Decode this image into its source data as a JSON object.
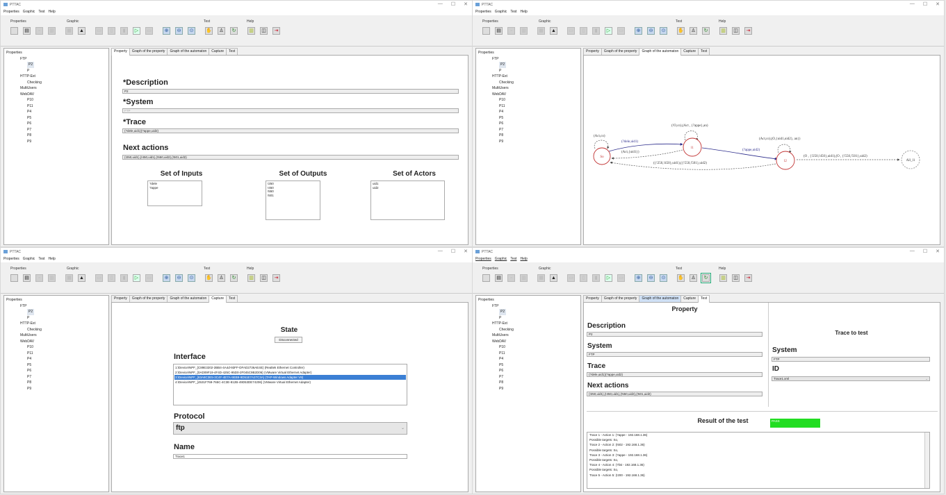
{
  "app": {
    "title": "PTTAC",
    "menu": [
      "Properties",
      "Graphic",
      "Test",
      "Help"
    ],
    "groups": [
      "Properties",
      "Graphic",
      "Test",
      "Help"
    ],
    "controls": [
      "—",
      "☐",
      "✕"
    ]
  },
  "tree": {
    "root": "Properties",
    "items": [
      {
        "label": "FTP",
        "level": 1
      },
      {
        "label": "P2",
        "level": 2,
        "selected": true
      },
      {
        "label": "P",
        "level": 2
      },
      {
        "label": "HTTP-Ext",
        "level": 1
      },
      {
        "label": "Checking",
        "level": 2
      },
      {
        "label": "MultiUsers",
        "level": 1
      },
      {
        "label": "WebDAV",
        "level": 1
      },
      {
        "label": "P10",
        "level": 2
      },
      {
        "label": "P11",
        "level": 2
      },
      {
        "label": "P4",
        "level": 2
      },
      {
        "label": "P5",
        "level": 2
      },
      {
        "label": "P6",
        "level": 2
      },
      {
        "label": "P7",
        "level": 2
      },
      {
        "label": "P8",
        "level": 2
      },
      {
        "label": "P9",
        "level": 2
      }
    ]
  },
  "tabs": [
    "Property",
    "Graph of the property",
    "Graph of the automaton",
    "Capture",
    "Test"
  ],
  "property": {
    "description_label": "*Description",
    "description_value": "P2",
    "system_label": "*System",
    "system_value": "FTP",
    "trace_label": "*Trace",
    "trace_value": "(?dele,uid1)(?appe,uid2)",
    "next_label": "Next actions",
    "next_value": "(!250,uid1),(!450,uid1),(!550,uid2),(!501,uid2)",
    "inputs_label": "Set of Inputs",
    "inputs": [
      "?dele",
      "?appe"
    ],
    "outputs_label": "Set of Outputs",
    "outputs": [
      "!250",
      "!450",
      "!550",
      "!501"
    ],
    "actors_label": "Set of Actors",
    "actors": [
      "uid1",
      "uid2"
    ]
  },
  "graph": {
    "nodes": [
      "So",
      "l1",
      "l2",
      "All_l1"
    ],
    "labels": [
      "(Act,co)",
      "(!O,co),(Act , {?appe},an)",
      "(?dele,uid1)",
      "(Act,{uid1})",
      "(Act,co),(O,{uid1,uid2}, an})",
      "(?appe,uid2)",
      "({!250,!450},uid1),({!550,!501},uid2)",
      "(O , {!250,!450},uid1),(O , {!550,!501},uid2)"
    ]
  },
  "capture": {
    "state_label": "State",
    "state_value": "Disconnected",
    "interface_label": "Interface",
    "interfaces": [
      "1:\\Device\\NPF_{C89E3202-2BB4-4A4d-93FF-DFAD2736AE4E} (Realtek Ethernet Controller)",
      "2:\\Device\\NPF_{0AD09F19-4F4D-425C-95D0-2F045C9B2D06} (VMware Virtual Ethernet Adapter)",
      "3:\\Device\\NPF_{63A8C3E5-3C4F-4E7A-9EB9-9D51E7A27C3A} (TAP-Windows Adapter V9)",
      "4:\\Device\\NPF_{4531F769-765C-4C3E-812B-49D53DE74206} (VMware Virtual Ethernet Adapter)"
    ],
    "selected_interface": 2,
    "protocol_label": "Protocol",
    "protocol_value": "ftp",
    "name_label": "Name",
    "name_value": "Trace1"
  },
  "test": {
    "property_title": "Property",
    "description_label": "Description",
    "description_value": "P2",
    "system_label": "System",
    "system_value": "FTP",
    "trace_label": "Trace",
    "trace_value": "(?dele,uid1)(?appe,uid2)",
    "next_label": "Next actions",
    "next_value": "(!250,uid1),(!450,uid1),(!550,uid2),(!501,uid2)",
    "trace_to_test_title": "Trace to test",
    "system2_label": "System",
    "system2_value": "FTP",
    "id_label": "ID",
    "id_value": "Trace1.xml",
    "result_label": "Result of the test",
    "result_value": "PASS",
    "result_color": "#22dd22",
    "log": [
      "Trace 1 - Action 1: (?appe - 192.168.1.36)",
      "Possible targets: So,",
      "Trace 2 - Action 2: (!502 - 192.168.1.36)",
      "Possible targets: So,",
      "Trace 3 - Action 3: (?appe - 192.168.1.36)",
      "Possible targets: So,",
      "Trace 4 - Action 4: (?list - 192.168.1.36)",
      "Possible targets: So,",
      "Trace 5 - Action 5: (!200 - 192.168.1.36)"
    ]
  }
}
